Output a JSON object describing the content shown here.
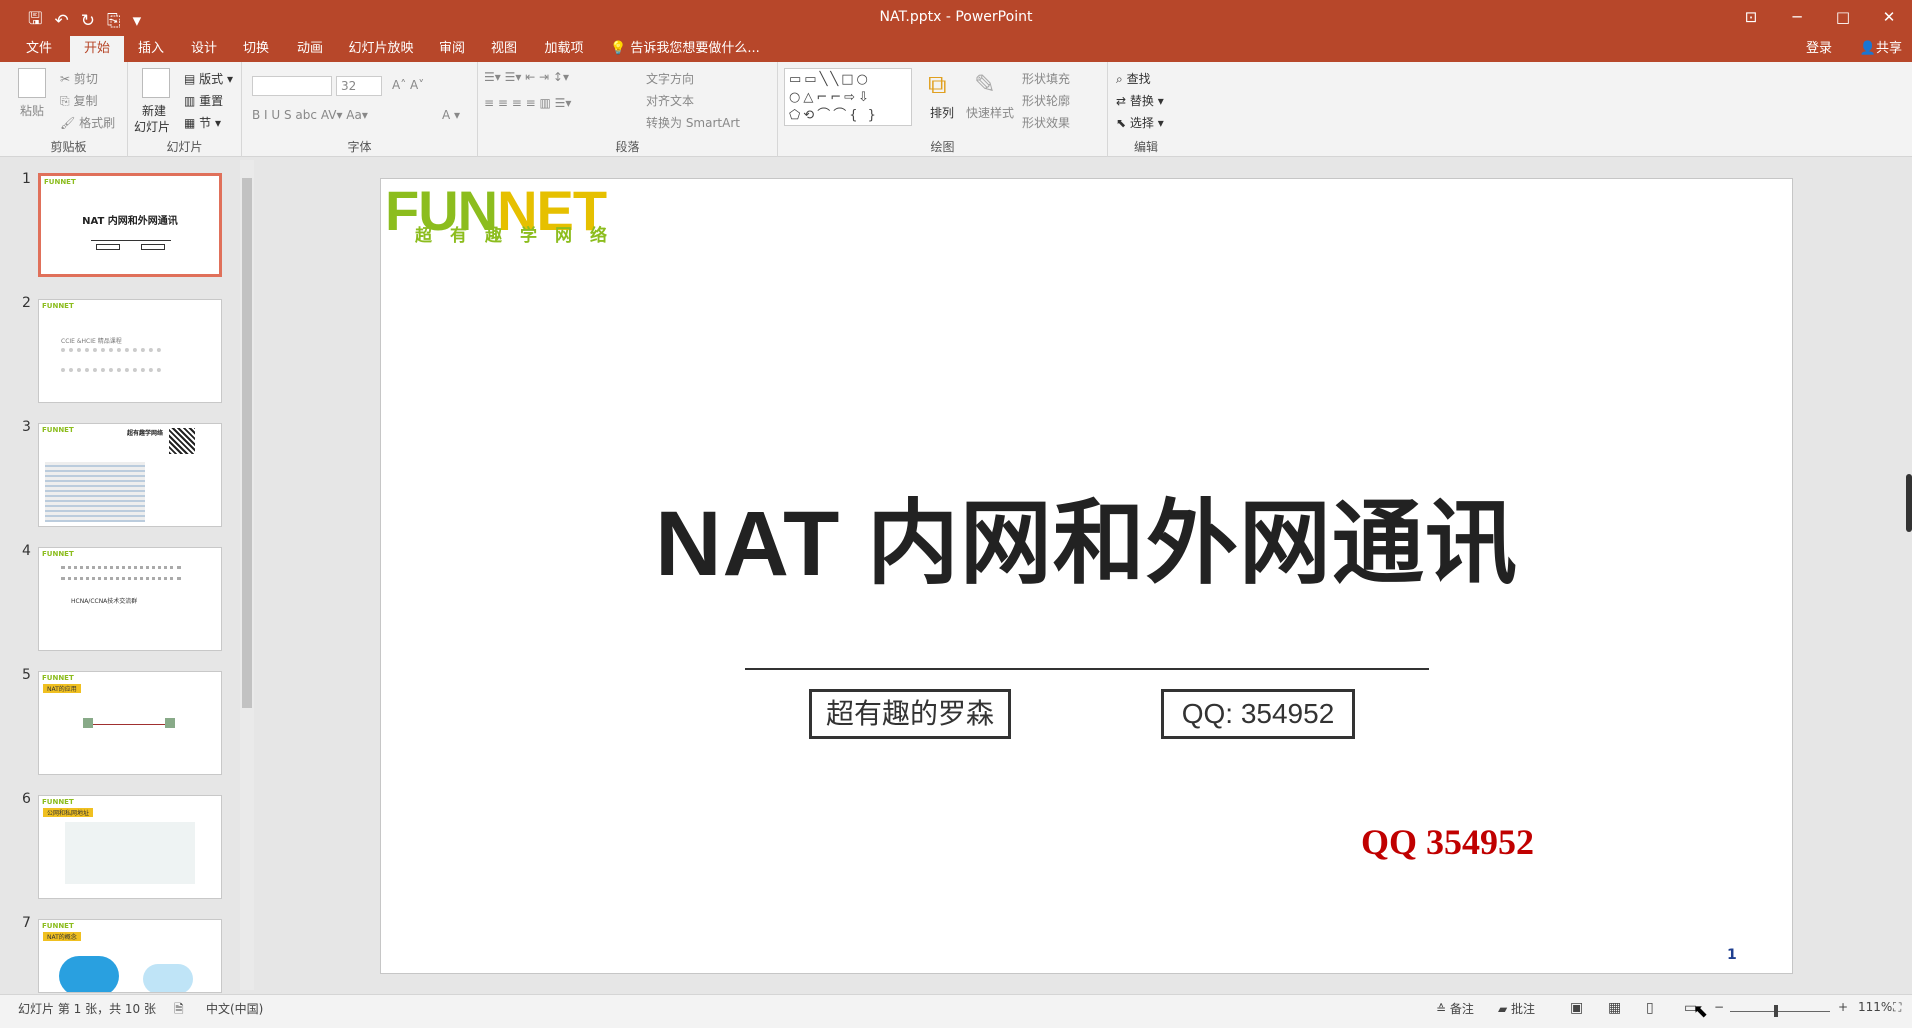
{
  "window": {
    "title": "NAT.pptx - PowerPoint"
  },
  "qat": {
    "save": "🖫",
    "undo": "↶",
    "redo": "↻",
    "start": "⎘",
    "more": "▾"
  },
  "tabs": [
    "文件",
    "开始",
    "插入",
    "设计",
    "切换",
    "动画",
    "幻灯片放映",
    "审阅",
    "视图",
    "加载项"
  ],
  "tell_me": "💡 告诉我您想要做什么...",
  "login": "登录",
  "share": "共享",
  "ribbon": {
    "clipboard": {
      "paste": "粘贴",
      "cut": "剪切",
      "copy": "复制",
      "format_painter": "格式刷",
      "label": "剪贴板"
    },
    "slides": {
      "new_slide_1": "新建",
      "new_slide_2": "幻灯片",
      "layout": "版式",
      "reset": "重置",
      "section": "节",
      "label": "幻灯片"
    },
    "font": {
      "font_size": "32",
      "label": "字体",
      "buttons": "B  I  U  S  abc  AV▾  Aa▾",
      "grow": "A˄  A˅",
      "color": "A ▾"
    },
    "paragraph": {
      "text_direction": "文字方向",
      "align_text": "对齐文本",
      "convert_smartart": "转换为 SmartArt",
      "label": "段落"
    },
    "drawing": {
      "arrange": "排列",
      "quick_styles": "快速样式",
      "shape_fill": "形状填充",
      "shape_outline": "形状轮廓",
      "shape_effects": "形状效果",
      "label": "绘图",
      "shapes": "▭▭╲╲□○\n○△⌐⌐⇨⇩\n⬠⟲⌒⌒{ }"
    },
    "editing": {
      "find": "查找",
      "replace": "替换",
      "select": "选择",
      "label": "编辑"
    }
  },
  "thumbnails": [
    {
      "num": "1",
      "text": "NAT 内网和外网通讯"
    },
    {
      "num": "2",
      "text": "CCIE &HCIE 精品课程"
    },
    {
      "num": "3",
      "text": "超有趣学网络"
    },
    {
      "num": "4",
      "text": "HCNA/CCNA技术交流群"
    },
    {
      "num": "5",
      "text": "NAT的应用"
    },
    {
      "num": "6",
      "text": "公网和私网地址"
    },
    {
      "num": "7",
      "text": "NAT的概念"
    }
  ],
  "slide": {
    "logo": "FUNNET",
    "logo_sub": "超有趣学网络",
    "title": "NAT 内网和外网通讯",
    "author": "超有趣的罗森",
    "qq_box": "QQ: 354952",
    "qq_red": "QQ 354952",
    "page_number": "1"
  },
  "status": {
    "slide_info": "幻灯片 第 1 张，共 10 张",
    "language": "中文(中国)",
    "notes": "备注",
    "comments": "批注",
    "zoom": "111%"
  }
}
